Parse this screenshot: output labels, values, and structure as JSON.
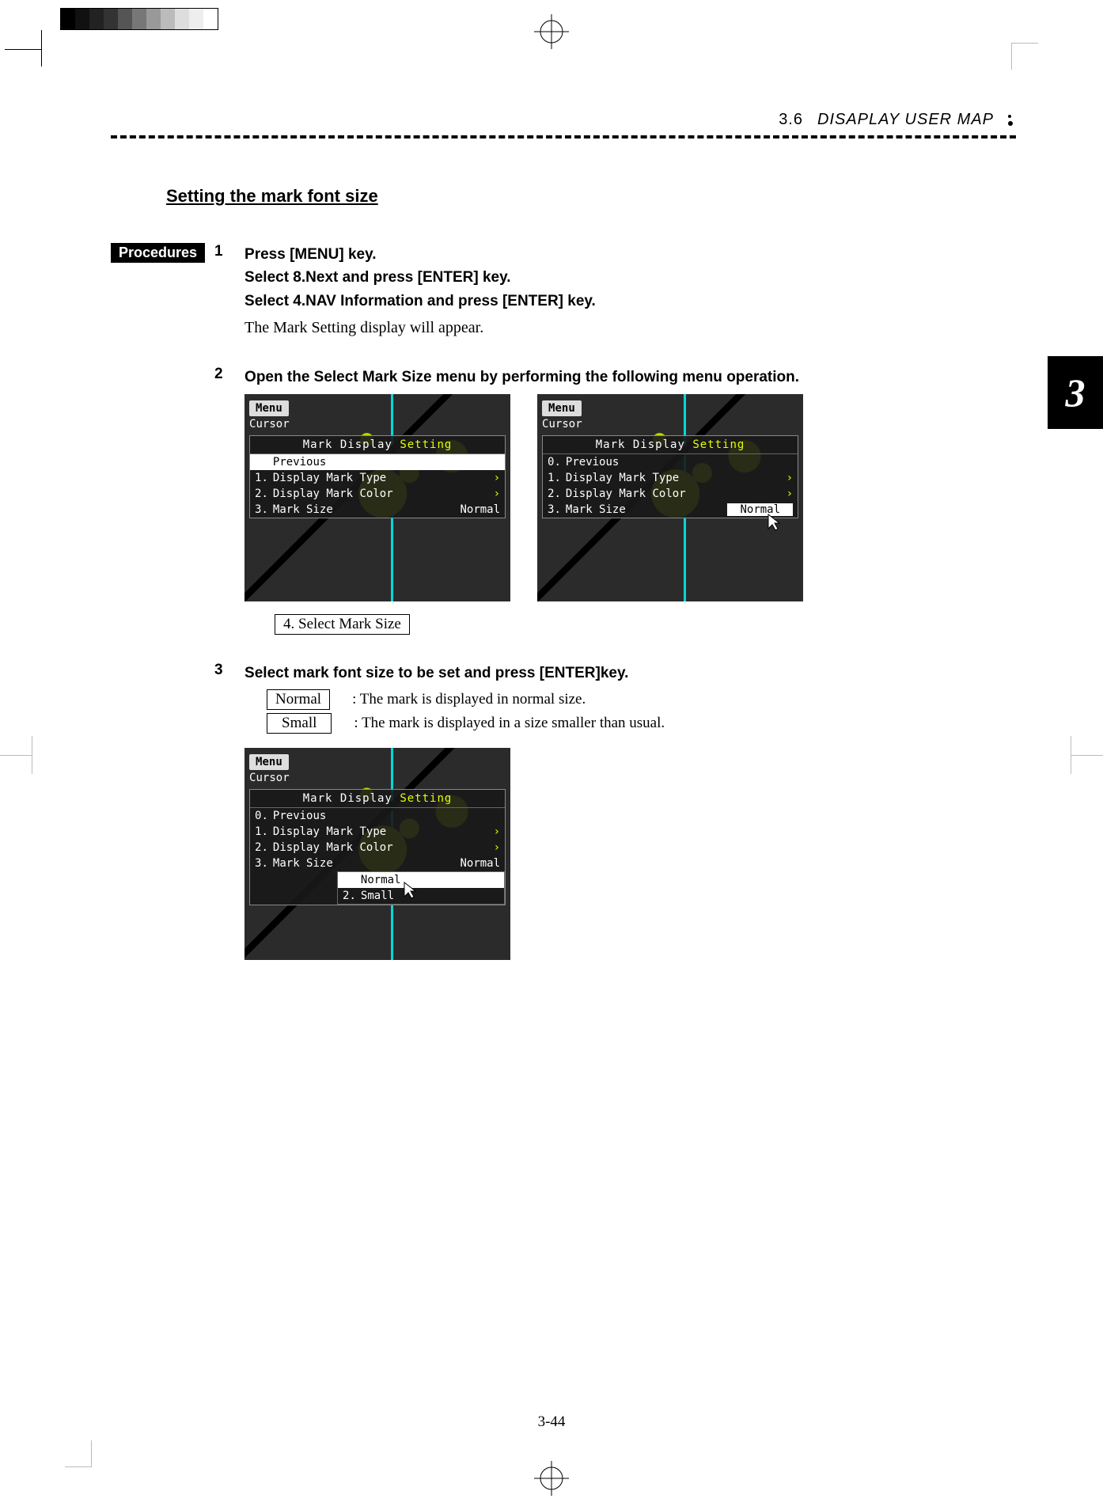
{
  "header": {
    "section": "3.6",
    "title": "DISAPLAY  USER  MAP"
  },
  "chapter_tab": "3",
  "subtitle": "Setting the mark font size",
  "procedures_label": "Procedures",
  "steps": {
    "s1": {
      "num": "1",
      "l1": "Press [MENU] key.",
      "l2": "Select   8.Next   and press [ENTER] key.",
      "l3": "Select   4.NAV Information and press [ENTER] key.",
      "note": "The Mark Setting display will appear."
    },
    "s2": {
      "num": "2",
      "l1": "Open the Select Mark Size menu by performing the following menu operation.",
      "between_box": "4. Select Mark Size"
    },
    "s3": {
      "num": "3",
      "l1": "Select mark font size to be set and press [ENTER]key."
    }
  },
  "options": {
    "normal": {
      "label": "Normal",
      "desc": ": The mark is displayed in normal size."
    },
    "small": {
      "label": "Small",
      "desc": ": The mark is displayed in a size smaller than usual."
    }
  },
  "panel": {
    "menu": "Menu",
    "cursor": "Cursor",
    "title_a": "Mark  Display",
    "title_b": "Setting",
    "r0": "Previous",
    "r1": "Display  Mark  Type",
    "r2": "Display  Mark  Color",
    "r3": "Mark  Size",
    "val_normal": "Normal",
    "sub_normal": "Normal",
    "sub_small": "Small"
  },
  "page_footer": "3-44"
}
